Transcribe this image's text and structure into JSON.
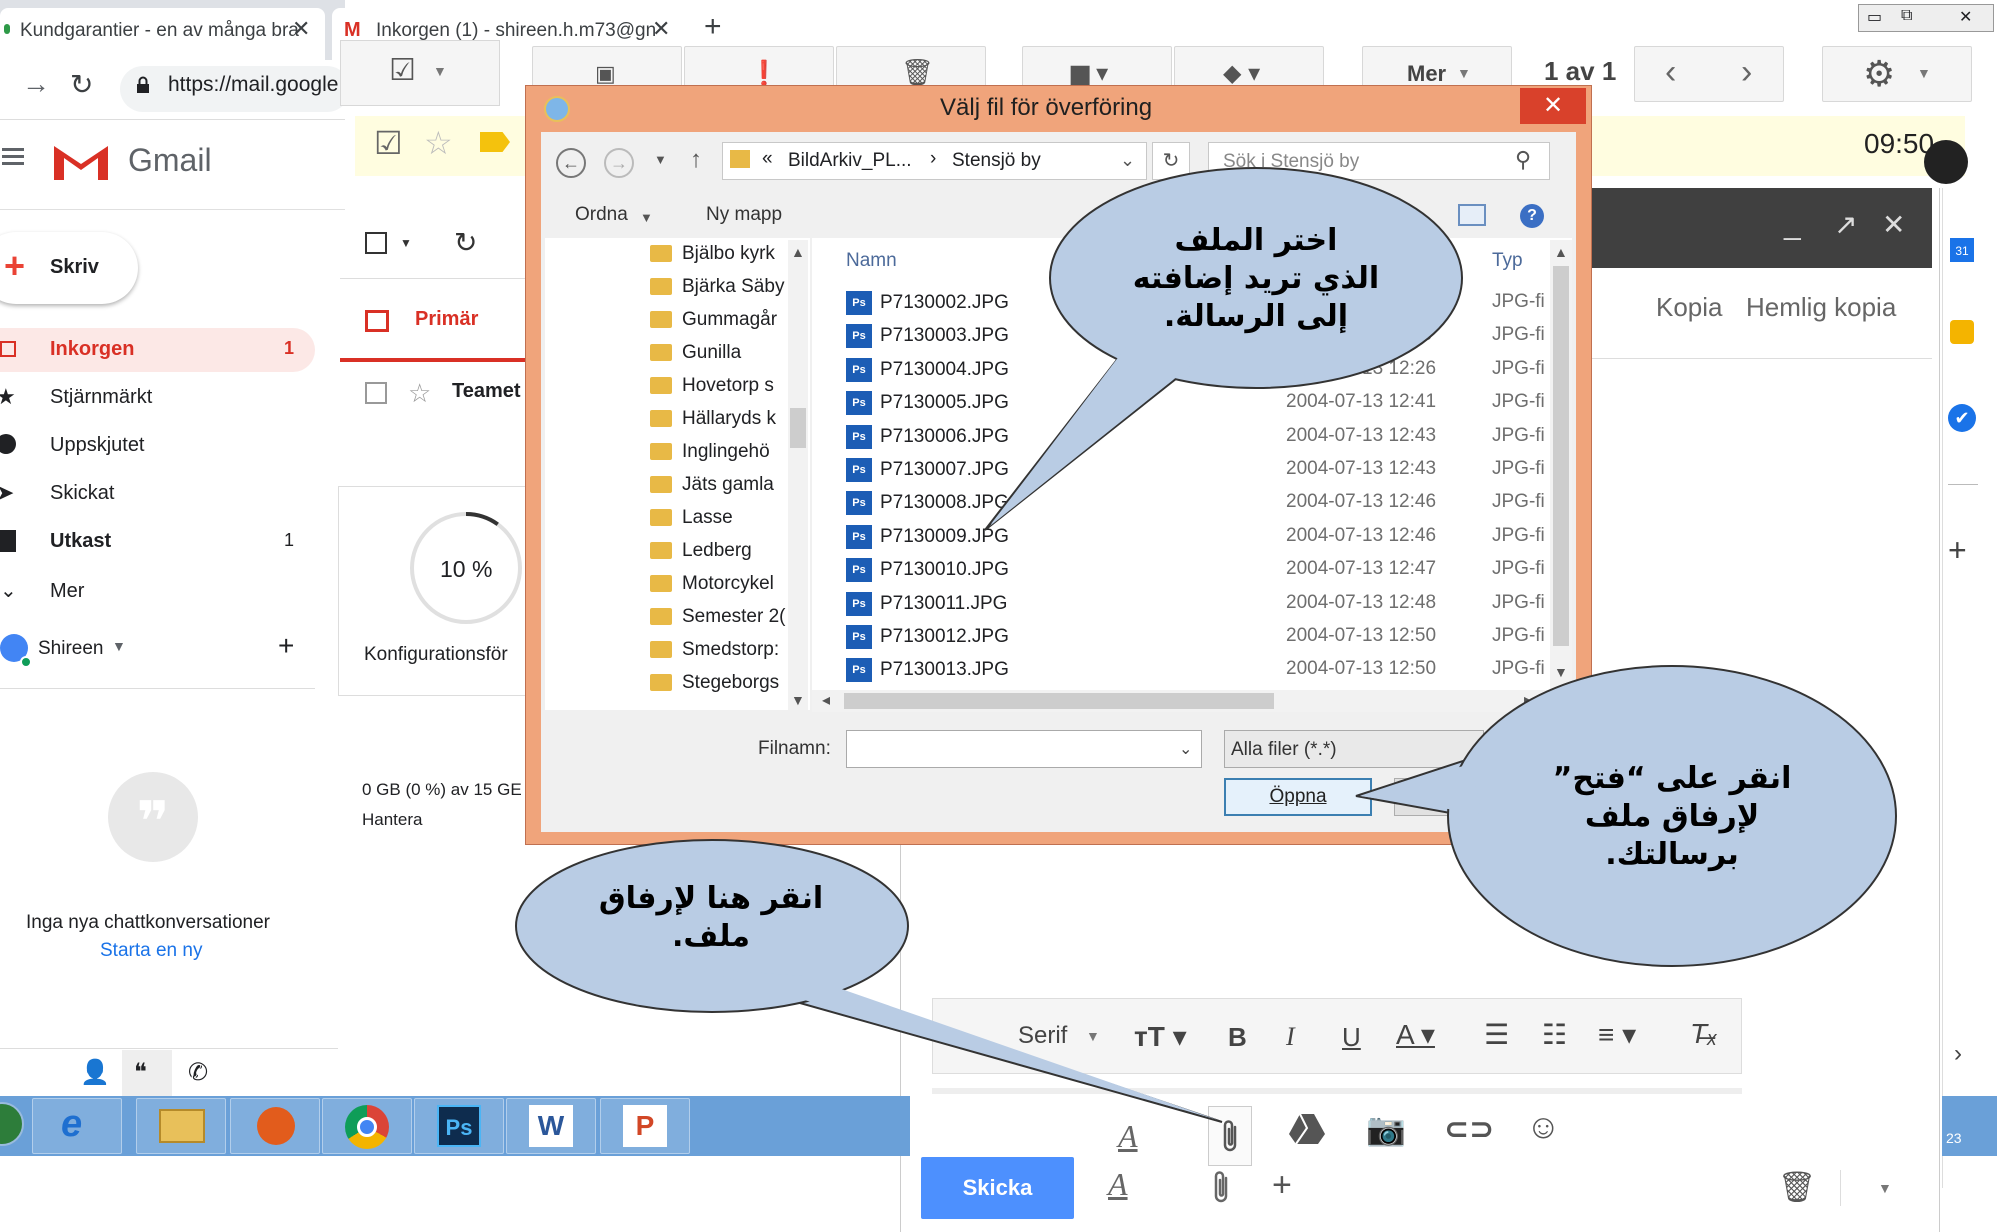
{
  "browser": {
    "tab_title": "Kundgarantier - en av många bra",
    "tab2_title": "Inkorgen (1) - shireen.h.m73@gn",
    "url": "https://mail.google"
  },
  "gmail": {
    "app_name": "Gmail",
    "compose_label": "Skriv",
    "nav": [
      {
        "label": "Inkorgen",
        "count": "1"
      },
      {
        "label": "Stjärnmärkt",
        "count": ""
      },
      {
        "label": "Uppskjutet",
        "count": ""
      },
      {
        "label": "Skickat",
        "count": ""
      },
      {
        "label": "Utkast",
        "count": "1"
      },
      {
        "label": "Mer",
        "count": ""
      }
    ],
    "user_name": "Shireen",
    "no_chats": "Inga nya chattkonversationer",
    "start_new": "Starta en ny",
    "tab_primary": "Primär",
    "message_sender": "Teamet",
    "progress_label": "10 %",
    "progress_fraction": 0.1,
    "config_label": "Konfigurationsför",
    "storage": "0 GB (0 %) av 15 GE",
    "manage": "Hantera",
    "more_label": "Mer",
    "pager": "1 av 1",
    "time": "09:50",
    "cc": "Kopia",
    "bcc": "Hemlig kopia",
    "font_label": "Serif",
    "send_label": "Skicka",
    "side_badge": "23"
  },
  "dialog": {
    "title": "Välj fil för överföring",
    "path_prefix": "«",
    "path_1": "BildArkiv_PL...",
    "path_sep": "›",
    "path_2": "Stensjö by",
    "search_placeholder": "Sök i Stensjö by",
    "organize": "Ordna",
    "new_folder": "Ny mapp",
    "col_name": "Namn",
    "col_type": "Typ",
    "folders": [
      "Bjälbo kyrk",
      "Bjärka Säby",
      "Gummagår",
      "Gunilla",
      "Hovetorp s",
      "Hällaryds k",
      "Inglingehö",
      "Jäts gamla",
      "Lasse",
      "Ledberg",
      "Motorcykel",
      "Semester 2(",
      "Smedstorp:",
      "Stegeborgs"
    ],
    "files": [
      {
        "name": "P7130002.JPG",
        "date": "",
        "type": "JPG-fi"
      },
      {
        "name": "P7130003.JPG",
        "date": "2:23",
        "type": "JPG-fi"
      },
      {
        "name": "P7130004.JPG",
        "date": "2004-07-13 12:26",
        "type": "JPG-fi"
      },
      {
        "name": "P7130005.JPG",
        "date": "2004-07-13 12:41",
        "type": "JPG-fi"
      },
      {
        "name": "P7130006.JPG",
        "date": "2004-07-13 12:43",
        "type": "JPG-fi"
      },
      {
        "name": "P7130007.JPG",
        "date": "2004-07-13 12:43",
        "type": "JPG-fi"
      },
      {
        "name": "P7130008.JPG",
        "date": "2004-07-13 12:46",
        "type": "JPG-fi"
      },
      {
        "name": "P7130009.JPG",
        "date": "2004-07-13 12:46",
        "type": "JPG-fi"
      },
      {
        "name": "P7130010.JPG",
        "date": "2004-07-13 12:47",
        "type": "JPG-fi"
      },
      {
        "name": "P7130011.JPG",
        "date": "2004-07-13 12:48",
        "type": "JPG-fi"
      },
      {
        "name": "P7130012.JPG",
        "date": "2004-07-13 12:50",
        "type": "JPG-fi"
      },
      {
        "name": "P7130013.JPG",
        "date": "2004-07-13 12:50",
        "type": "JPG-fi"
      }
    ],
    "filename_label": "Filnamn:",
    "filter": "Alla filer (*.*)",
    "open_button": "Öppna"
  },
  "callouts": {
    "select_file": [
      "اختر الملف",
      "الذي تريد إضافته",
      "إلى الرسالة."
    ],
    "click_open": [
      "انقر على “فتح”",
      "لإرفاق ملف",
      "برسالتك."
    ],
    "click_here": [
      "انقر هنا لإرفاق",
      "ملف."
    ]
  }
}
